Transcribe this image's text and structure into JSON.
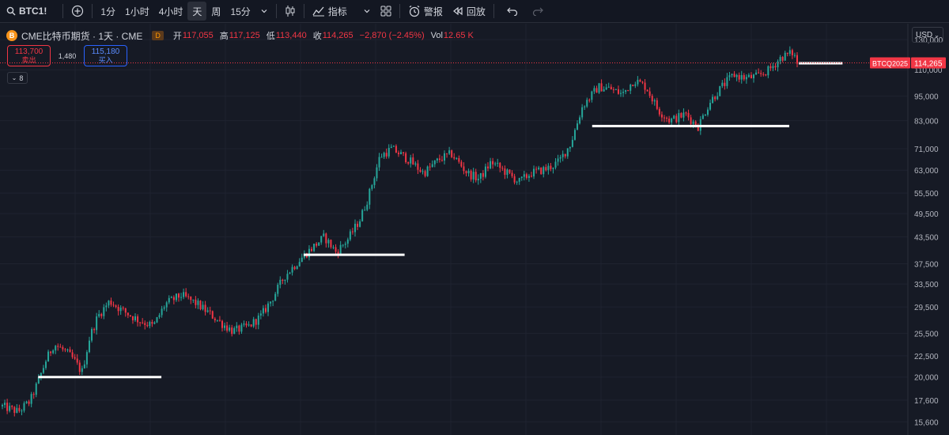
{
  "toolbar": {
    "symbol": "BTC1!",
    "intervals": [
      "1分",
      "1小时",
      "4小时",
      "天",
      "周",
      "15分"
    ],
    "active_interval": "天",
    "indicators_label": "指标",
    "alert_label": "警报",
    "replay_label": "回放",
    "icons": [
      "search-icon",
      "plus-circle-icon",
      "chevron-down-icon",
      "candles-icon",
      "indicators-icon",
      "grid-icon",
      "alarm-icon",
      "replay-icon",
      "undo-icon",
      "redo-icon"
    ]
  },
  "legend": {
    "logo_letter": "B",
    "title": "CME比特币期货 · 1天 · CME",
    "badge": "D",
    "open_key": "开",
    "open": "117,055",
    "high_key": "高",
    "high": "117,125",
    "low_key": "低",
    "low": "113,440",
    "close_key": "收",
    "close": "114,265",
    "change": "−2,870 (−2.45%)",
    "vol_key": "Vol",
    "vol": "12.65 K"
  },
  "trade": {
    "sell_price": "113,700",
    "sell_label": "卖出",
    "spread": "1,480",
    "buy_price": "115,180",
    "buy_label": "买入"
  },
  "collapse_label": "8",
  "currency": "USD",
  "colors": {
    "up": "#26a69a",
    "down": "#f23645",
    "background": "#161a25",
    "hline": "#ffffff"
  },
  "chart_data": {
    "type": "candlestick",
    "scale": "log",
    "y_ticks": [
      130000,
      110000,
      95000,
      83000,
      71000,
      63000,
      55500,
      49500,
      43500,
      37500,
      33500,
      29500,
      25500,
      22500,
      20000,
      17600,
      15600
    ],
    "y_tick_labels": [
      "130,000",
      "110,000",
      "95,000",
      "83,000",
      "71,000",
      "63,000",
      "55,500",
      "49,500",
      "43,500",
      "37,500",
      "33,500",
      "29,500",
      "25,500",
      "22,500",
      "20,000",
      "17,600",
      "15,600"
    ],
    "ylim": [
      14500,
      142000
    ],
    "last_price": 114265,
    "last_price_label": "114,265",
    "contract_label": "BTCQ2025",
    "price_path": [
      [
        0.0,
        17000
      ],
      [
        0.02,
        16500
      ],
      [
        0.035,
        17500
      ],
      [
        0.045,
        19500
      ],
      [
        0.055,
        22000
      ],
      [
        0.065,
        24000
      ],
      [
        0.08,
        23000
      ],
      [
        0.09,
        22000
      ],
      [
        0.1,
        20500
      ],
      [
        0.11,
        25000
      ],
      [
        0.12,
        28000
      ],
      [
        0.135,
        30500
      ],
      [
        0.15,
        29000
      ],
      [
        0.17,
        27500
      ],
      [
        0.19,
        26500
      ],
      [
        0.205,
        30000
      ],
      [
        0.225,
        31500
      ],
      [
        0.245,
        30000
      ],
      [
        0.26,
        28500
      ],
      [
        0.275,
        27000
      ],
      [
        0.29,
        25800
      ],
      [
        0.31,
        26500
      ],
      [
        0.325,
        28000
      ],
      [
        0.34,
        31000
      ],
      [
        0.355,
        35000
      ],
      [
        0.375,
        38500
      ],
      [
        0.39,
        41000
      ],
      [
        0.405,
        43500
      ],
      [
        0.42,
        40000
      ],
      [
        0.435,
        43000
      ],
      [
        0.45,
        48000
      ],
      [
        0.46,
        54000
      ],
      [
        0.475,
        68000
      ],
      [
        0.49,
        71000
      ],
      [
        0.51,
        67000
      ],
      [
        0.53,
        62000
      ],
      [
        0.55,
        67000
      ],
      [
        0.565,
        69000
      ],
      [
        0.585,
        62000
      ],
      [
        0.6,
        60000
      ],
      [
        0.615,
        66000
      ],
      [
        0.63,
        63000
      ],
      [
        0.65,
        59000
      ],
      [
        0.665,
        62000
      ],
      [
        0.685,
        63500
      ],
      [
        0.7,
        66000
      ],
      [
        0.715,
        73000
      ],
      [
        0.73,
        90000
      ],
      [
        0.75,
        100000
      ],
      [
        0.765,
        99000
      ],
      [
        0.78,
        96000
      ],
      [
        0.795,
        104000
      ],
      [
        0.81,
        100000
      ],
      [
        0.825,
        88000
      ],
      [
        0.84,
        83000
      ],
      [
        0.86,
        86000
      ],
      [
        0.875,
        80000
      ],
      [
        0.89,
        92000
      ],
      [
        0.905,
        100000
      ],
      [
        0.92,
        107000
      ],
      [
        0.935,
        105000
      ],
      [
        0.95,
        106000
      ],
      [
        0.965,
        110000
      ],
      [
        0.98,
        118000
      ],
      [
        0.995,
        121000
      ],
      [
        1.0,
        114265
      ]
    ],
    "horizontal_lines": [
      {
        "price": 20000,
        "x_from": 0.058,
        "x_to": 0.213
      },
      {
        "price": 39400,
        "x_from": 0.392,
        "x_to": 0.519
      },
      {
        "price": 80500,
        "x_from": 0.755,
        "x_to": 1.003
      },
      {
        "price": 114000,
        "x_from": 1.015,
        "x_to": 1.07
      }
    ]
  }
}
